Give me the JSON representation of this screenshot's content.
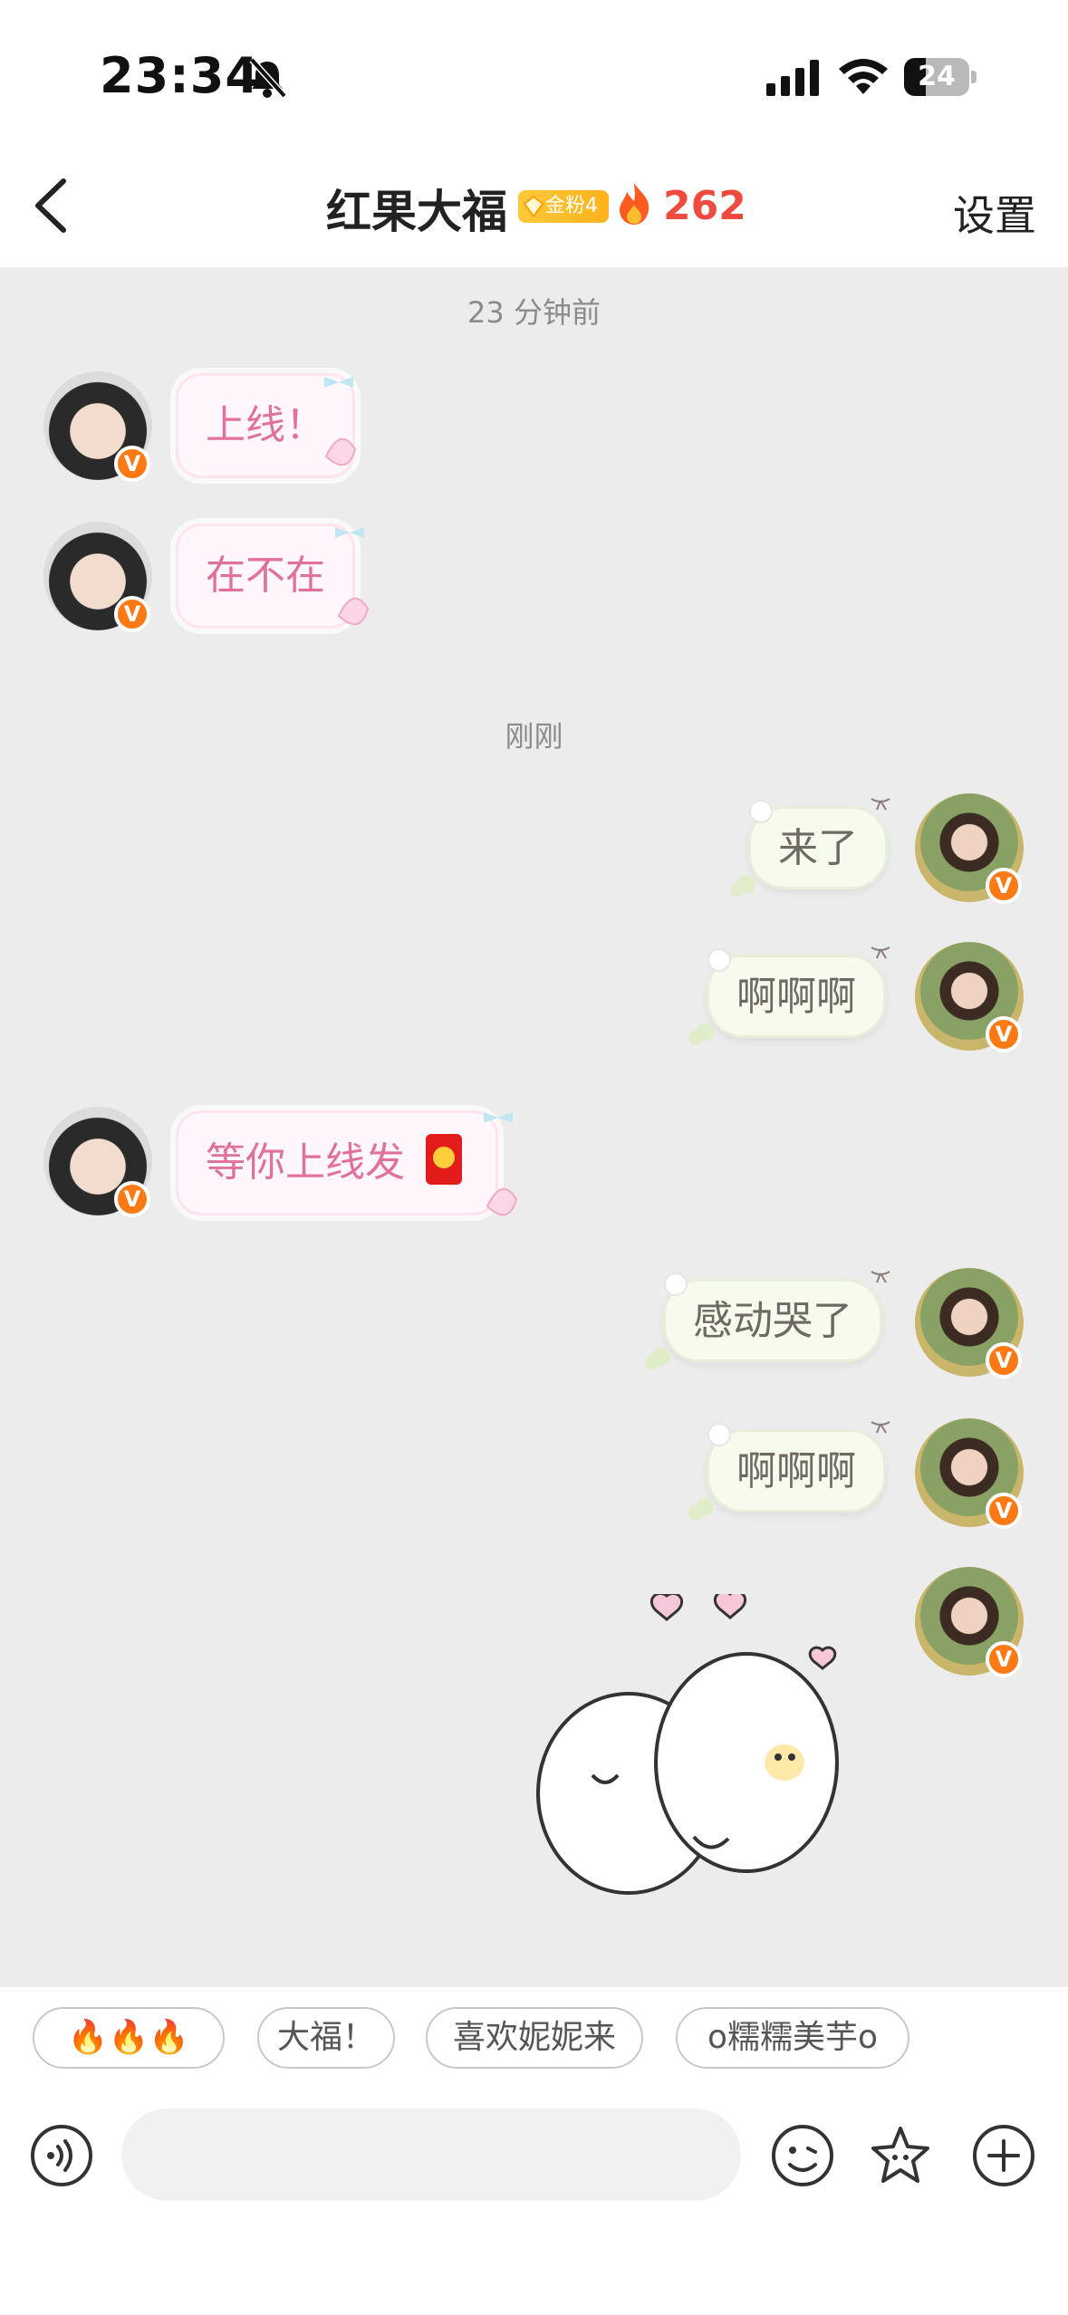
{
  "status_bar": {
    "time": "23:34",
    "battery": "24"
  },
  "header": {
    "title": "红果大福",
    "fan_badge": "金粉4",
    "fire_count": "262",
    "settings_label": "设置"
  },
  "timestamps": {
    "first": "23 分钟前",
    "second": "刚刚"
  },
  "messages": [
    {
      "side": "left",
      "text": "上线！"
    },
    {
      "side": "left",
      "text": "在不在"
    },
    {
      "side": "right",
      "text": "来了"
    },
    {
      "side": "right",
      "text": "啊啊啊"
    },
    {
      "side": "left",
      "text": "等你上线发"
    },
    {
      "side": "right",
      "text": "感动哭了"
    },
    {
      "side": "right",
      "text": "啊啊啊"
    },
    {
      "side": "right",
      "type": "sticker"
    }
  ],
  "quick_replies": [
    "🔥🔥🔥",
    "大福！",
    "喜欢妮妮来",
    "o糯糯美芋o"
  ],
  "input": {
    "placeholder": ""
  },
  "icons": {
    "voice": "voice-icon",
    "emoji": "emoji-icon",
    "favorite_sticker": "star-sticker-icon",
    "more": "plus-icon",
    "back": "back-arrow-icon",
    "mute": "bell-mute-icon",
    "fire": "fire-icon",
    "red_packet": "red-packet-icon"
  },
  "colors": {
    "accent_fire": "#f04a3e",
    "left_text": "#e0709d",
    "verify_badge": "#ff7a14",
    "gold_badge": "#ffc93a"
  }
}
